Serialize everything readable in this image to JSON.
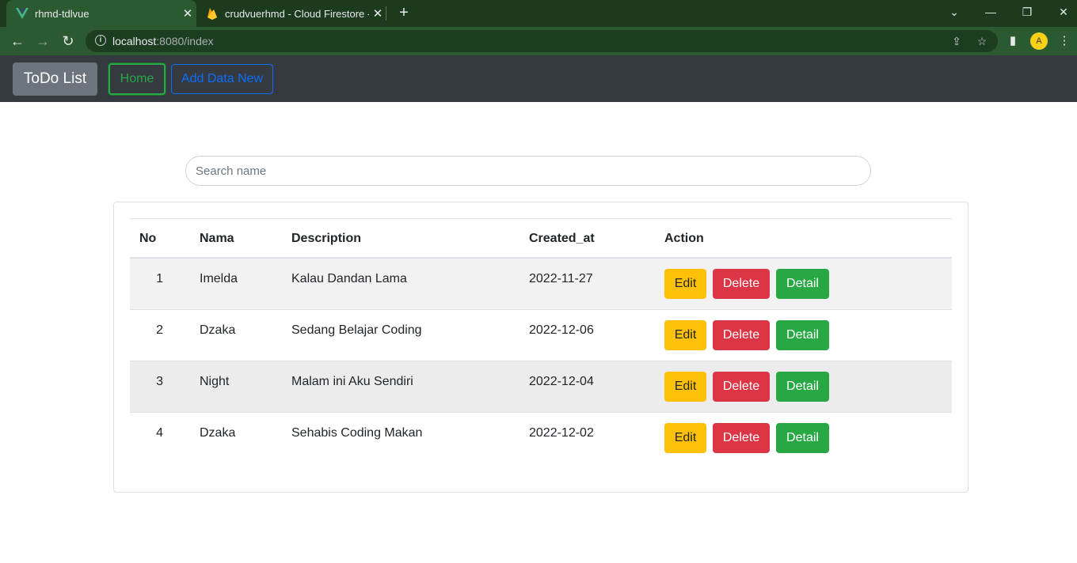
{
  "browser": {
    "tabs": [
      {
        "title": "rhmd-tdlvue",
        "icon": "vue-logo-icon",
        "active": true
      },
      {
        "title": "crudvuerhmd - Cloud Firestore -",
        "icon": "firebase-flame-icon",
        "active": false
      }
    ],
    "url_host": "localhost",
    "url_path": ":8080/index",
    "accent_color": "#2c5a30"
  },
  "navbar": {
    "brand": "ToDo List",
    "home_label": "Home",
    "add_label": "Add Data New"
  },
  "search": {
    "placeholder": "Search name",
    "value": ""
  },
  "table": {
    "headers": [
      "No",
      "Nama",
      "Description",
      "Created_at",
      "Action"
    ],
    "rows": [
      {
        "no": "1",
        "nama": "Imelda",
        "description": "Kalau Dandan Lama",
        "created_at": "2022-11-27"
      },
      {
        "no": "2",
        "nama": "Dzaka",
        "description": "Sedang Belajar Coding",
        "created_at": "2022-12-06"
      },
      {
        "no": "3",
        "nama": "Night",
        "description": "Malam ini Aku Sendiri",
        "created_at": "2022-12-04"
      },
      {
        "no": "4",
        "nama": "Dzaka",
        "description": "Sehabis Coding Makan",
        "created_at": "2022-12-02"
      }
    ],
    "actions": {
      "edit": "Edit",
      "delete": "Delete",
      "detail": "Detail"
    }
  }
}
